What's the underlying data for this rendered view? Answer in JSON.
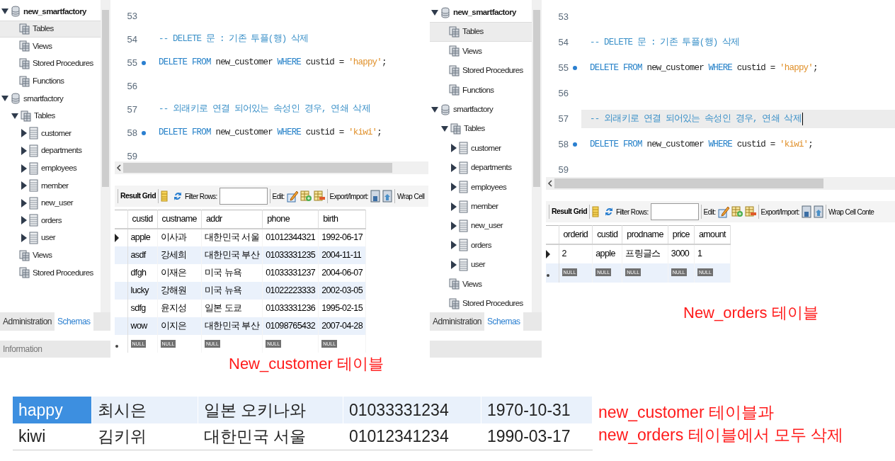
{
  "panels": [
    {
      "sidebar": {
        "tree": [
          {
            "label": "new_smartfactory",
            "kind": "schema",
            "active": true,
            "expanded": true,
            "selected": false,
            "children": [
              {
                "label": "Tables",
                "kind": "group",
                "selected": true
              },
              {
                "label": "Views",
                "kind": "group",
                "selected": false
              },
              {
                "label": "Stored Procedures",
                "kind": "group",
                "selected": false
              },
              {
                "label": "Functions",
                "kind": "group",
                "selected": false
              }
            ]
          },
          {
            "label": "smartfactory",
            "kind": "schema",
            "active": false,
            "expanded": true,
            "selected": false,
            "children": [
              {
                "label": "Tables",
                "kind": "group",
                "expanded": true,
                "selected": false,
                "children": [
                  {
                    "label": "customer",
                    "kind": "table",
                    "expanded": false,
                    "selected": false
                  },
                  {
                    "label": "departments",
                    "kind": "table",
                    "expanded": false,
                    "selected": false
                  },
                  {
                    "label": "employees",
                    "kind": "table",
                    "expanded": false,
                    "selected": false
                  },
                  {
                    "label": "member",
                    "kind": "table",
                    "expanded": false,
                    "selected": false
                  },
                  {
                    "label": "new_user",
                    "kind": "table",
                    "expanded": false,
                    "selected": false
                  },
                  {
                    "label": "orders",
                    "kind": "table",
                    "expanded": false,
                    "selected": false
                  },
                  {
                    "label": "user",
                    "kind": "table",
                    "expanded": false,
                    "selected": false
                  }
                ]
              },
              {
                "label": "Views",
                "kind": "group",
                "selected": false
              },
              {
                "label": "Stored Procedures",
                "kind": "group",
                "selected": false
              }
            ]
          }
        ],
        "tabs": [
          {
            "label": "Administration",
            "selected": false
          },
          {
            "label": "Schemas",
            "selected": true
          }
        ],
        "info_label": "Information"
      },
      "editor": {
        "lines": [
          {
            "number": "53",
            "breakpoint": false,
            "current": false
          },
          {
            "number": "54",
            "breakpoint": false,
            "current": false,
            "tokens": [
              {
                "kind": "comment",
                "text": "-- DELETE 문 : 기존 투플(행) 삭제"
              }
            ]
          },
          {
            "number": "55",
            "breakpoint": true,
            "current": false,
            "tokens": [
              {
                "kind": "keyword",
                "text": "DELETE"
              },
              {
                "kind": "keyword",
                "text": "FROM"
              },
              {
                "kind": "plain",
                "text": "new_customer"
              },
              {
                "kind": "keyword",
                "text": "WHERE"
              },
              {
                "kind": "plain",
                "text": "custid"
              },
              {
                "kind": "plain",
                "text": "="
              },
              {
                "kind": "string",
                "text": "'happy'"
              },
              {
                "kind": "punct",
                "text": ";"
              }
            ]
          },
          {
            "number": "56",
            "breakpoint": false,
            "current": false
          },
          {
            "number": "57",
            "breakpoint": false,
            "current": false,
            "tokens": [
              {
                "kind": "comment",
                "text": "-- 외래키로 연결 되어있는 속성인 경우, 연쇄 삭제"
              }
            ]
          },
          {
            "number": "58",
            "breakpoint": true,
            "current": false,
            "tokens": [
              {
                "kind": "keyword",
                "text": "DELETE"
              },
              {
                "kind": "keyword",
                "text": "FROM"
              },
              {
                "kind": "plain",
                "text": "new_customer"
              },
              {
                "kind": "keyword",
                "text": "WHERE"
              },
              {
                "kind": "plain",
                "text": "custid"
              },
              {
                "kind": "plain",
                "text": "="
              },
              {
                "kind": "string",
                "text": "'kiwi'"
              },
              {
                "kind": "punct",
                "text": ";"
              }
            ]
          },
          {
            "number": "59",
            "breakpoint": false,
            "current": false
          }
        ]
      },
      "toolbar": {
        "result_grid": "Result Grid",
        "filter_label": "Filter Rows:",
        "edit_label": "Edit:",
        "export_label": "Export/Import:",
        "wrap_label": "Wrap Cell"
      },
      "grid": {
        "columns": [
          "custid",
          "custname",
          "addr",
          "phone",
          "birth"
        ],
        "rows": [
          {
            "kind": "data",
            "current": true,
            "cells": [
              "apple",
              "이사과",
              "대한민국 서울",
              "01012344321",
              "1992-06-17"
            ]
          },
          {
            "kind": "data",
            "current": false,
            "cells": [
              "asdf",
              "강세희",
              "대한민국 부산",
              "01033331235",
              "2004-11-11"
            ]
          },
          {
            "kind": "data",
            "current": false,
            "cells": [
              "dfgh",
              "이재은",
              "미국 뉴욕",
              "01033331237",
              "2004-06-07"
            ]
          },
          {
            "kind": "data",
            "current": false,
            "cells": [
              "lucky",
              "강해원",
              "미국 뉴욕",
              "01022223333",
              "2002-03-05"
            ]
          },
          {
            "kind": "data",
            "current": false,
            "cells": [
              "sdfg",
              "윤지성",
              "일본 도쿄",
              "01033331236",
              "1995-02-15"
            ]
          },
          {
            "kind": "data",
            "current": false,
            "cells": [
              "wow",
              "이지은",
              "대한민국 부산",
              "01098765432",
              "2007-04-28"
            ]
          },
          {
            "kind": "new",
            "current": false,
            "cells": [
              "NULL",
              "NULL",
              "NULL",
              "NULL",
              "NULL"
            ]
          }
        ]
      },
      "caption": "New_customer 테이블"
    },
    {
      "sidebar": {
        "tree": [
          {
            "label": "new_smartfactory",
            "kind": "schema",
            "active": true,
            "expanded": true,
            "selected": false,
            "children": [
              {
                "label": "Tables",
                "kind": "group",
                "selected": true
              },
              {
                "label": "Views",
                "kind": "group",
                "selected": false
              },
              {
                "label": "Stored Procedures",
                "kind": "group",
                "selected": false
              },
              {
                "label": "Functions",
                "kind": "group",
                "selected": false
              }
            ]
          },
          {
            "label": "smartfactory",
            "kind": "schema",
            "active": false,
            "expanded": true,
            "selected": false,
            "children": [
              {
                "label": "Tables",
                "kind": "group",
                "expanded": true,
                "selected": false,
                "children": [
                  {
                    "label": "customer",
                    "kind": "table",
                    "expanded": false,
                    "selected": false
                  },
                  {
                    "label": "departments",
                    "kind": "table",
                    "expanded": false,
                    "selected": false
                  },
                  {
                    "label": "employees",
                    "kind": "table",
                    "expanded": false,
                    "selected": false
                  },
                  {
                    "label": "member",
                    "kind": "table",
                    "expanded": false,
                    "selected": false
                  },
                  {
                    "label": "new_user",
                    "kind": "table",
                    "expanded": false,
                    "selected": false
                  },
                  {
                    "label": "orders",
                    "kind": "table",
                    "expanded": false,
                    "selected": false
                  },
                  {
                    "label": "user",
                    "kind": "table",
                    "expanded": false,
                    "selected": false
                  }
                ]
              },
              {
                "label": "Views",
                "kind": "group",
                "selected": false
              },
              {
                "label": "Stored Procedures",
                "kind": "group",
                "selected": false
              }
            ]
          }
        ],
        "tabs": [
          {
            "label": "Administration",
            "selected": false
          },
          {
            "label": "Schemas",
            "selected": true
          }
        ]
      },
      "editor": {
        "lines": [
          {
            "number": "53",
            "breakpoint": false,
            "current": false
          },
          {
            "number": "54",
            "breakpoint": false,
            "current": false,
            "tokens": [
              {
                "kind": "comment",
                "text": "-- DELETE 문 : 기존 투플(행) 삭제"
              }
            ]
          },
          {
            "number": "55",
            "breakpoint": true,
            "current": false,
            "tokens": [
              {
                "kind": "keyword",
                "text": "DELETE"
              },
              {
                "kind": "keyword",
                "text": "FROM"
              },
              {
                "kind": "plain",
                "text": "new_customer"
              },
              {
                "kind": "keyword",
                "text": "WHERE"
              },
              {
                "kind": "plain",
                "text": "custid"
              },
              {
                "kind": "plain",
                "text": "="
              },
              {
                "kind": "string",
                "text": "'happy'"
              },
              {
                "kind": "punct",
                "text": ";"
              }
            ]
          },
          {
            "number": "56",
            "breakpoint": false,
            "current": false
          },
          {
            "number": "57",
            "breakpoint": false,
            "current": true,
            "tokens": [
              {
                "kind": "comment",
                "text": "-- 외래키로 연결 되어있는 속성인 경우, 연쇄 삭제"
              }
            ]
          },
          {
            "number": "58",
            "breakpoint": true,
            "current": false,
            "tokens": [
              {
                "kind": "keyword",
                "text": "DELETE"
              },
              {
                "kind": "keyword",
                "text": "FROM"
              },
              {
                "kind": "plain",
                "text": "new_customer"
              },
              {
                "kind": "keyword",
                "text": "WHERE"
              },
              {
                "kind": "plain",
                "text": "custid"
              },
              {
                "kind": "plain",
                "text": "="
              },
              {
                "kind": "string",
                "text": "'kiwi'"
              },
              {
                "kind": "punct",
                "text": ";"
              }
            ]
          },
          {
            "number": "59",
            "breakpoint": false,
            "current": false
          }
        ]
      },
      "toolbar": {
        "result_grid": "Result Grid",
        "filter_label": "Filter Rows:",
        "edit_label": "Edit:",
        "export_label": "Export/Import:",
        "wrap_label": "Wrap Cell Conte"
      },
      "grid": {
        "columns": [
          "orderid",
          "custid",
          "prodname",
          "price",
          "amount"
        ],
        "rows": [
          {
            "kind": "data",
            "current": true,
            "cells": [
              "2",
              "apple",
              "프링글스",
              "3000",
              "1"
            ]
          },
          {
            "kind": "new",
            "current": false,
            "cells": [
              "NULL",
              "NULL",
              "NULL",
              "NULL",
              "NULL"
            ]
          }
        ]
      },
      "caption": "New_orders 테이블"
    }
  ],
  "deleted_rows": [
    {
      "cells": [
        {
          "text": "happy",
          "selected": true
        },
        {
          "text": "최시은",
          "selected": false
        },
        {
          "text": "일본 오키나와",
          "selected": false
        },
        {
          "text": "01033331234",
          "selected": false
        },
        {
          "text": "1970-10-31",
          "selected": false
        }
      ]
    },
    {
      "cells": [
        {
          "text": "kiwi",
          "selected": false
        },
        {
          "text": "김키위",
          "selected": false
        },
        {
          "text": "대한민국 서울",
          "selected": false
        },
        {
          "text": "01012341234",
          "selected": false
        },
        {
          "text": "1990-03-17",
          "selected": false
        }
      ]
    }
  ],
  "note": [
    "new_customer 테이블과",
    "new_orders 테이블에서 모두 삭제"
  ]
}
